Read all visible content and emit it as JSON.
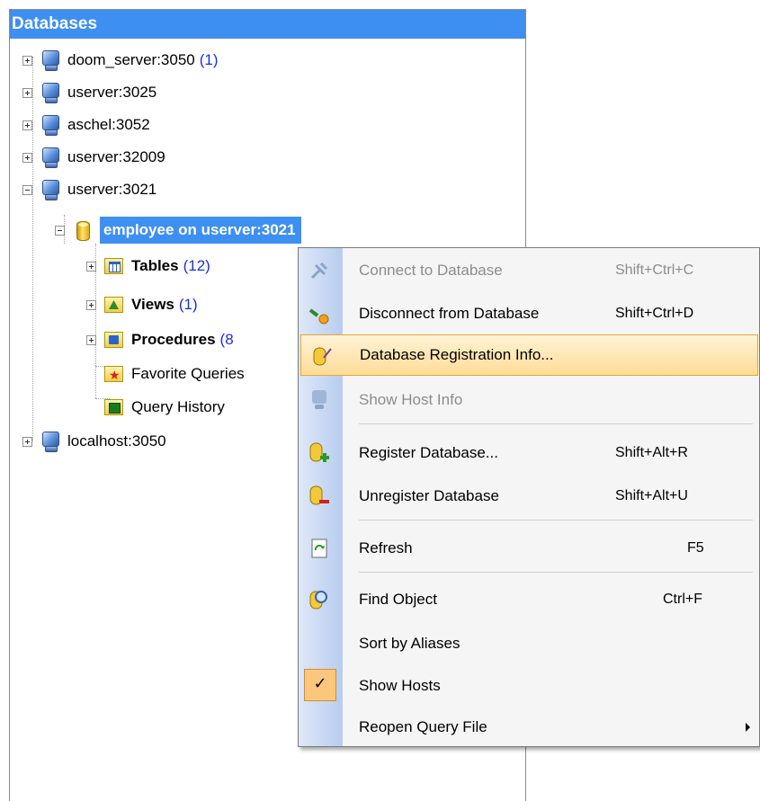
{
  "panel": {
    "title": "Databases"
  },
  "tree": {
    "servers": [
      {
        "label": "doom_server:3050",
        "count": "(1)"
      },
      {
        "label": "userver:3025"
      },
      {
        "label": "aschel:3052"
      },
      {
        "label": "userver:32009"
      },
      {
        "label": "userver:3021"
      }
    ],
    "database": {
      "label": "employee on userver:3021"
    },
    "children": [
      {
        "label": "Tables",
        "count": "(12)"
      },
      {
        "label": "Views",
        "count": "(1)"
      },
      {
        "label": "Procedures",
        "count": "(8"
      },
      {
        "label": "Favorite Queries"
      },
      {
        "label": "Query History"
      }
    ],
    "last_server": {
      "label": "localhost:3050"
    }
  },
  "context_menu": {
    "items": [
      {
        "label": "Connect to Database",
        "shortcut": "Shift+Ctrl+C",
        "enabled": false,
        "icon": "plug-icon"
      },
      {
        "label": "Disconnect from Database",
        "shortcut": "Shift+Ctrl+D",
        "enabled": true,
        "icon": "unplug-icon"
      },
      {
        "label": "Database Registration Info...",
        "shortcut": "",
        "enabled": true,
        "icon": "db-edit-icon"
      },
      {
        "label": "Show Host Info",
        "shortcut": "",
        "enabled": false,
        "icon": "server-icon"
      },
      {
        "label": "Register Database...",
        "shortcut": "Shift+Alt+R",
        "enabled": true,
        "icon": "db-add-icon"
      },
      {
        "label": "Unregister Database",
        "shortcut": "Shift+Alt+U",
        "enabled": true,
        "icon": "db-remove-icon"
      },
      {
        "label": "Refresh",
        "shortcut": "F5",
        "enabled": true,
        "icon": "refresh-icon"
      },
      {
        "label": "Find Object",
        "shortcut": "Ctrl+F",
        "enabled": true,
        "icon": "find-icon"
      },
      {
        "label": "Sort by Aliases",
        "shortcut": "",
        "enabled": true
      },
      {
        "label": "Show Hosts",
        "shortcut": "",
        "enabled": true,
        "checked": true,
        "check_glyph": "✓"
      },
      {
        "label": "Reopen Query File",
        "shortcut": "",
        "enabled": true,
        "submenu": true
      }
    ]
  },
  "colors": {
    "header_bg": "#3d8ff2",
    "selection_bg": "#3d8ff2",
    "count_text": "#1a2ee6",
    "menu_highlight": "#fddc97"
  }
}
